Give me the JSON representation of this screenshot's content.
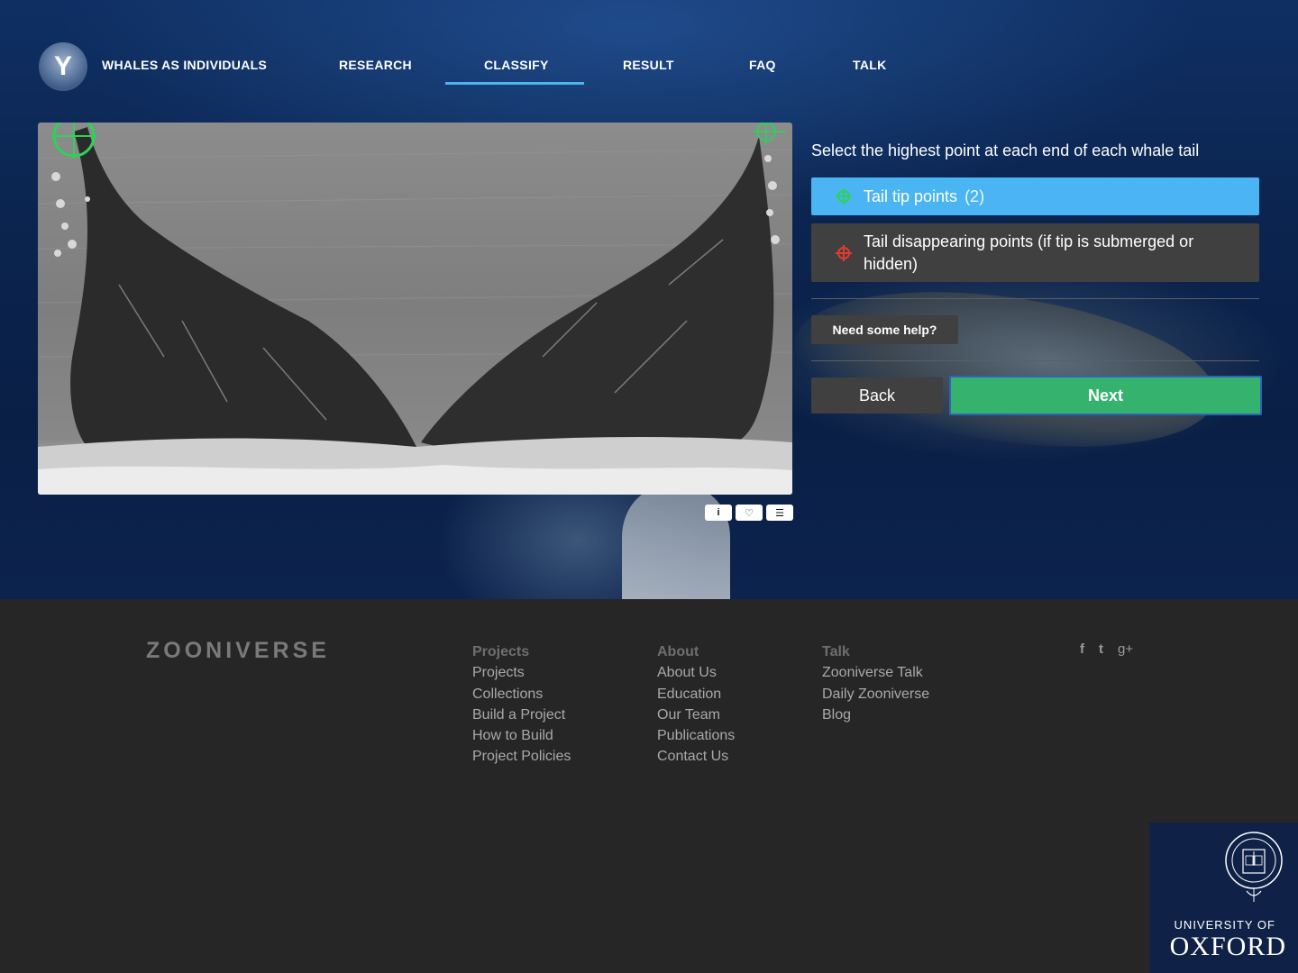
{
  "nav": {
    "logo_glyph": "Y",
    "title": "WHALES AS INDIVIDUALS",
    "items": [
      {
        "label": "RESEARCH",
        "active": false
      },
      {
        "label": "CLASSIFY",
        "active": true
      },
      {
        "label": "RESULT",
        "active": false
      },
      {
        "label": "FAQ",
        "active": false
      },
      {
        "label": "TALK",
        "active": false
      }
    ],
    "accent_color": "#4db6f0"
  },
  "subject": {
    "tools": [
      {
        "icon": "info-icon",
        "glyph": "i"
      },
      {
        "icon": "heart-icon",
        "glyph": "♡"
      },
      {
        "icon": "list-icon",
        "glyph": "☰"
      }
    ]
  },
  "task": {
    "question": "Select the highest point at each end of each whale tail",
    "choices": [
      {
        "label": "Tail tip points",
        "count": "(2)",
        "icon": "crosshair-green-icon",
        "color": "#2ed15a",
        "selected": true
      },
      {
        "label": "Tail disappearing points (if tip is submerged or hidden)",
        "count": "",
        "icon": "crosshair-red-icon",
        "color": "#e53a2f",
        "selected": false
      }
    ],
    "help_label": "Need some help?",
    "back_label": "Back",
    "next_label": "Next",
    "next_color": "#35b36e"
  },
  "footer": {
    "logo_text": "ZOONIVERSE",
    "columns": [
      {
        "heading": "Projects",
        "links": [
          "Projects",
          "Collections",
          "Build a Project",
          "How to Build",
          "Project Policies"
        ]
      },
      {
        "heading": "About",
        "links": [
          "About Us",
          "Education",
          "Our Team",
          "Publications",
          "Contact Us"
        ]
      },
      {
        "heading": "Talk",
        "links": [
          "Zooniverse Talk",
          "Daily Zooniverse",
          "Blog"
        ]
      }
    ],
    "social": [
      {
        "icon": "facebook-icon",
        "glyph": "f"
      },
      {
        "icon": "twitter-icon",
        "glyph": "t"
      },
      {
        "icon": "google-plus-icon",
        "glyph": "g+"
      }
    ]
  },
  "oxford": {
    "line1": "UNIVERSITY OF",
    "line2": "OXFORD"
  }
}
